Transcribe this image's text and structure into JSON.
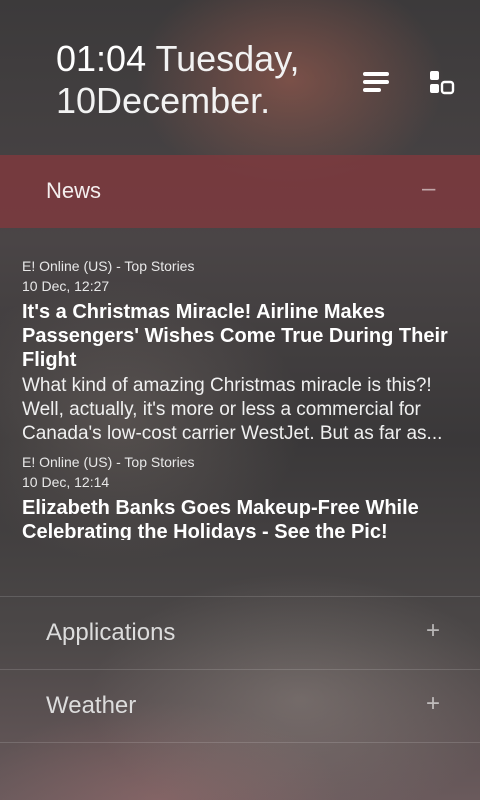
{
  "header": {
    "time": "01:04",
    "date": "Tuesday, 10December.",
    "icons": [
      "list-icon",
      "grid-icon"
    ]
  },
  "news": {
    "title": "News",
    "toggle": "–",
    "articles": [
      {
        "source": "E! Online (US) - Top Stories",
        "date": "10 Dec, 12:27",
        "headline": "It's a Christmas Miracle! Airline Makes Passengers' Wishes Come True During Their Flight",
        "summary": "What kind of amazing Christmas miracle is this?! Well, actually, it's more or less a commercial for Canada's low-cost carrier WestJet. But as far as..."
      },
      {
        "source": "E! Online (US) - Top Stories",
        "date": "10 Dec, 12:14",
        "headline": "Elizabeth Banks Goes Makeup-Free While Celebrating the Holidays - See the Pic!",
        "summary": ""
      }
    ]
  },
  "sections": {
    "applications": {
      "label": "Applications",
      "toggle": "+"
    },
    "weather": {
      "label": "Weather",
      "toggle": "+"
    }
  }
}
